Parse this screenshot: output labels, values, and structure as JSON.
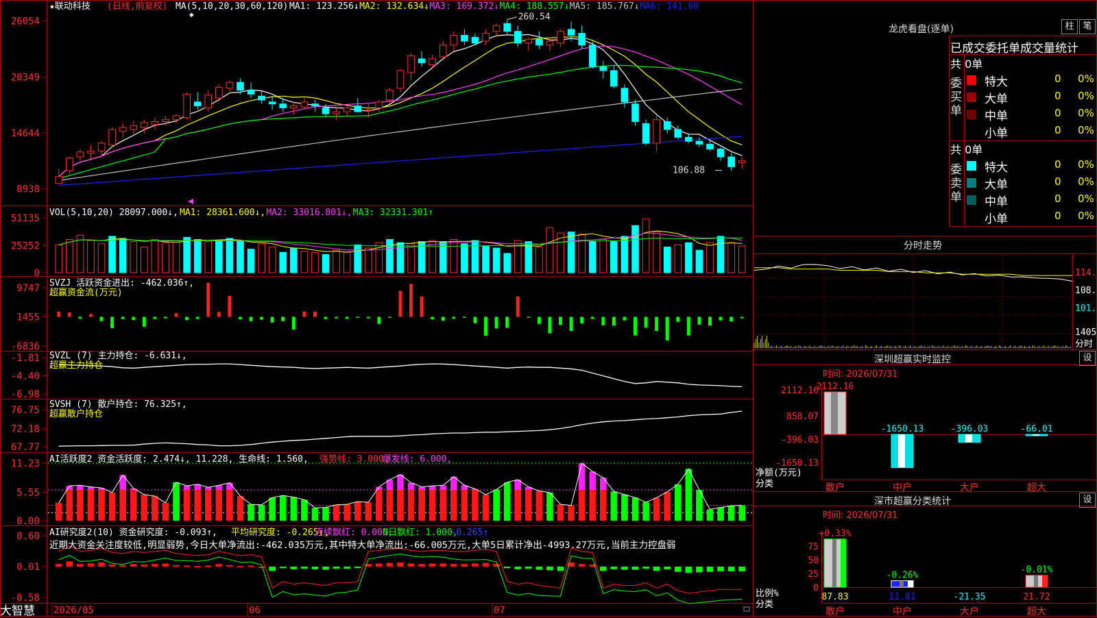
{
  "app": {
    "brand": "大智慧"
  },
  "main": {
    "stock_name": "联动科技",
    "period_label": "(日线,前复权)",
    "ma_label": "MA(5,10,20,30,60,120)",
    "ma_values": [
      {
        "label": "MA1: 123.256↓",
        "color": "#ffffff"
      },
      {
        "label": "MA2: 132.634↓",
        "color": "#ffff00"
      },
      {
        "label": "MA3: 169.372↓",
        "color": "#ff40ff"
      },
      {
        "label": "MA4: 188.557↓",
        "color": "#00ff00"
      },
      {
        "label": "MA5: 185.767↓",
        "color": "#c0c0c0"
      },
      {
        "label": "MA6: 141.60",
        "color": "#2020ff"
      }
    ],
    "y_ticks": [
      "26054",
      "20349",
      "14644",
      "8938"
    ],
    "high_label": "260.54",
    "low_label": "106.88",
    "x_ticks": [
      "2026/05",
      "06",
      "07"
    ]
  },
  "vol": {
    "label": "VOL(5,10,20) 28097.000↓,",
    "ma_labels": [
      {
        "label": "MA1: 28361.600↓,",
        "color": "#ffff00"
      },
      {
        "label": "MA2: 33016.801↓,",
        "color": "#ff40ff"
      },
      {
        "label": "MA3: 32331.301↑",
        "color": "#00ff00"
      }
    ],
    "y_ticks": [
      "51135",
      "25252",
      "0"
    ]
  },
  "svzj": {
    "label": "SVZJ  活跃资金进出: -462.036↑,",
    "sub_label": "超赢资金流(万元)",
    "y_ticks": [
      "9747",
      "1455",
      "-6836"
    ]
  },
  "svzl": {
    "label": "SVZL (7) 主力持仓: -6.631↓,",
    "sub_label": "超赢主力持仓",
    "y_ticks": [
      "-1.81",
      "-4.40",
      "-6.98"
    ]
  },
  "svsh": {
    "label": "SVSH (7) 散户持仓: 76.325↑,",
    "sub_label": "超赢散户持仓",
    "y_ticks": [
      "76.75",
      "72.18",
      "67.77"
    ]
  },
  "ai1": {
    "label": "AI活跃度2 资金活跃度: 2.474↓, 11.228, 生命线: 1.560,",
    "extra": [
      {
        "label": "强势线: 3.000,",
        "color": "#ff3030"
      },
      {
        "label": "爆发线: 6.000,",
        "color": "#ff40ff"
      }
    ],
    "y_ticks": [
      "11.23",
      "5.55",
      "0.00"
    ]
  },
  "ai2": {
    "label": "AI研究度2(10) 资金研究度: -0.093↑,",
    "extra": [
      {
        "label": "平均研究度: -0.265↑,",
        "color": "#ffff00"
      },
      {
        "label": "连续飘红: 0.000,",
        "color": "#ff40ff"
      },
      {
        "label": "N日飘红: 1.000,",
        "color": "#00ff00"
      },
      {
        "label": "-0.265↑",
        "color": "#4040ff"
      }
    ],
    "comment": "近期大资金关注度较低,明显弱势,今日大单净流出:-462.035万元,其中特大单净流出:-66.005万元,大单5日累计净出-4993.27万元,当前主力控盘弱",
    "y_ticks": [
      "0.60",
      "0.01",
      "-0.58"
    ]
  },
  "right": {
    "dragon": {
      "title": "龙虎看盘(逐单)",
      "btn1": "柱",
      "btn2": "笔",
      "header": "已成交委托单成交量统计",
      "buy_side": "委买单",
      "sell_side": "委卖单",
      "buy_total": "共 0单",
      "sell_total": "共 0单",
      "buy_rows": [
        {
          "name": "特大",
          "count": "0",
          "pct": "0%",
          "color": "#ff0000"
        },
        {
          "name": "大单",
          "count": "0",
          "pct": "0%",
          "color": "#a00000"
        },
        {
          "name": "中单",
          "count": "0",
          "pct": "0%",
          "color": "#700000"
        },
        {
          "name": "小单",
          "count": "0",
          "pct": "0%",
          "color": ""
        }
      ],
      "sell_rows": [
        {
          "name": "特大",
          "count": "0",
          "pct": "0%",
          "color": "#00ffff"
        },
        {
          "name": "大单",
          "count": "0",
          "pct": "0%",
          "color": "#008080"
        },
        {
          "name": "中单",
          "count": "0",
          "pct": "0%",
          "color": "#006060"
        },
        {
          "name": "小单",
          "count": "0",
          "pct": "0%",
          "color": ""
        }
      ]
    },
    "intraday": {
      "title": "分时走势",
      "price_ticks": [
        "114.8",
        "108.2",
        "101.5"
      ],
      "vol_tick": "1405",
      "vol_label": "分时"
    },
    "monitor": {
      "title": "深圳超赢实时监控",
      "settings": "设",
      "time": "时间: 2026/07/31",
      "y_ticks": [
        "2112.16",
        "858.07",
        "-396.03",
        "-1650.13"
      ],
      "unit_label": "净额(万元)",
      "cat_label": "分类",
      "categories": [
        "散户",
        "中户",
        "大户",
        "超大"
      ],
      "values": [
        2112.16,
        -1650.13,
        -396.03,
        -66.01
      ],
      "value_labels": [
        "2112.16",
        "-1650.13",
        "-396.03",
        "-66.01"
      ]
    },
    "classify": {
      "title": "深市超赢分类统计",
      "settings": "设",
      "time": "时间: 2026/07/31",
      "y_ticks": [
        "75",
        "50",
        "25",
        "0"
      ],
      "ratio_label": "比例%",
      "cat_label": "分类",
      "categories": [
        "散户",
        "中户",
        "大户",
        "超大"
      ],
      "bar_labels": [
        "+0.33%",
        "-0.26%",
        "",
        "-0.01%"
      ],
      "values": [
        87.83,
        11.81,
        -21.35,
        21.72
      ],
      "value_labels": [
        "87.83",
        "11.81",
        "-21.35",
        "21.72"
      ]
    }
  },
  "chart_data": {
    "type": "candlestick",
    "title": "联动科技",
    "x_axis_ticks": [
      "2026/05",
      "06",
      "07"
    ],
    "ylim": [
      8938,
      26054
    ],
    "high": 260.54,
    "low": 106.88,
    "candles": [
      [
        95,
        110,
        95,
        102
      ],
      [
        108,
        122,
        104,
        121
      ],
      [
        122,
        130,
        118,
        127
      ],
      [
        126,
        134,
        120,
        128
      ],
      [
        128,
        138,
        124,
        136
      ],
      [
        134,
        152,
        131,
        150
      ],
      [
        148,
        157,
        142,
        152
      ],
      [
        150,
        159,
        146,
        154
      ],
      [
        152,
        160,
        146,
        157
      ],
      [
        155,
        162,
        150,
        158
      ],
      [
        158,
        163,
        154,
        160
      ],
      [
        160,
        166,
        156,
        164
      ],
      [
        162,
        188,
        160,
        186
      ],
      [
        178,
        188,
        170,
        174
      ],
      [
        172,
        190,
        168,
        185
      ],
      [
        182,
        196,
        178,
        193
      ],
      [
        192,
        200,
        186,
        198
      ],
      [
        198,
        202,
        186,
        190
      ],
      [
        190,
        198,
        182,
        186
      ],
      [
        184,
        190,
        176,
        180
      ],
      [
        178,
        184,
        170,
        176
      ],
      [
        176,
        182,
        168,
        172
      ],
      [
        172,
        178,
        166,
        174
      ],
      [
        173,
        182,
        170,
        178
      ],
      [
        176,
        180,
        168,
        174
      ],
      [
        172,
        176,
        162,
        166
      ],
      [
        166,
        172,
        160,
        168
      ],
      [
        168,
        174,
        164,
        172
      ],
      [
        174,
        182,
        168,
        168
      ],
      [
        170,
        176,
        162,
        170
      ],
      [
        172,
        180,
        168,
        178
      ],
      [
        180,
        192,
        176,
        190
      ],
      [
        192,
        212,
        188,
        210
      ],
      [
        208,
        228,
        200,
        225
      ],
      [
        222,
        230,
        214,
        218
      ],
      [
        216,
        226,
        212,
        222
      ],
      [
        224,
        240,
        220,
        236
      ],
      [
        236,
        250,
        230,
        246
      ],
      [
        246,
        252,
        236,
        240
      ],
      [
        244,
        248,
        236,
        238
      ],
      [
        240,
        252,
        236,
        248
      ],
      [
        250,
        258,
        244,
        256
      ],
      [
        258,
        262,
        246,
        250
      ],
      [
        250,
        256,
        234,
        238
      ],
      [
        238,
        244,
        230,
        242
      ],
      [
        242,
        250,
        232,
        236
      ],
      [
        236,
        244,
        230,
        240
      ],
      [
        238,
        252,
        234,
        250
      ],
      [
        252,
        260,
        240,
        246
      ],
      [
        248,
        256,
        232,
        236
      ],
      [
        236,
        240,
        212,
        214
      ],
      [
        214,
        220,
        202,
        210
      ],
      [
        210,
        216,
        192,
        194
      ],
      [
        192,
        196,
        172,
        178
      ],
      [
        176,
        180,
        154,
        158
      ],
      [
        156,
        160,
        134,
        136
      ],
      [
        136,
        164,
        128,
        160
      ],
      [
        158,
        162,
        146,
        150
      ],
      [
        150,
        154,
        140,
        142
      ],
      [
        142,
        146,
        136,
        138
      ],
      [
        138,
        142,
        132,
        135
      ],
      [
        135,
        140,
        128,
        130
      ],
      [
        130,
        132,
        118,
        122
      ],
      [
        122,
        126,
        108,
        112
      ],
      [
        116,
        122,
        110,
        118
      ]
    ],
    "volume": [
      [
        26000,
        1
      ],
      [
        31000,
        1
      ],
      [
        35000,
        1
      ],
      [
        30000,
        1
      ],
      [
        27000,
        1
      ],
      [
        34000,
        0
      ],
      [
        32000,
        0
      ],
      [
        29000,
        1
      ],
      [
        24000,
        1
      ],
      [
        31000,
        1
      ],
      [
        28000,
        1
      ],
      [
        30000,
        1
      ],
      [
        33000,
        0
      ],
      [
        31000,
        0
      ],
      [
        29000,
        1
      ],
      [
        30000,
        0
      ],
      [
        32000,
        0
      ],
      [
        30000,
        0
      ],
      [
        22000,
        0
      ],
      [
        27000,
        1
      ],
      [
        24000,
        1
      ],
      [
        19000,
        0
      ],
      [
        23000,
        0
      ],
      [
        20000,
        1
      ],
      [
        19000,
        1
      ],
      [
        17000,
        0
      ],
      [
        21000,
        1
      ],
      [
        19000,
        1
      ],
      [
        26000,
        0
      ],
      [
        23000,
        1
      ],
      [
        28000,
        1
      ],
      [
        31000,
        0
      ],
      [
        28000,
        0
      ],
      [
        27000,
        1
      ],
      [
        29000,
        0
      ],
      [
        30000,
        1
      ],
      [
        29000,
        0
      ],
      [
        31000,
        1
      ],
      [
        27000,
        0
      ],
      [
        30000,
        0
      ],
      [
        25000,
        0
      ],
      [
        23000,
        0
      ],
      [
        18000,
        0
      ],
      [
        30000,
        1
      ],
      [
        29000,
        0
      ],
      [
        24000,
        1
      ],
      [
        42000,
        1
      ],
      [
        37000,
        1
      ],
      [
        38000,
        0
      ],
      [
        36000,
        1
      ],
      [
        29000,
        0
      ],
      [
        31000,
        1
      ],
      [
        29000,
        0
      ],
      [
        34000,
        0
      ],
      [
        44000,
        0
      ],
      [
        50000,
        1
      ],
      [
        38000,
        1
      ],
      [
        24000,
        0
      ],
      [
        26000,
        1
      ],
      [
        28000,
        0
      ],
      [
        21000,
        0
      ],
      [
        28000,
        1
      ],
      [
        34000,
        0
      ],
      [
        28000,
        1
      ],
      [
        25000,
        1
      ]
    ],
    "svzj": [
      1500,
      1300,
      -500,
      800,
      -1200,
      -3200,
      -600,
      -900,
      -2800,
      -600,
      -400,
      1100,
      -900,
      -600,
      9700,
      1400,
      6000,
      -700,
      -1200,
      -800,
      -1600,
      -1200,
      -3600,
      1500,
      1500,
      -600,
      -400,
      -500,
      -300,
      -400,
      -2000,
      -300,
      7400,
      9400,
      5800,
      -700,
      -1100,
      -500,
      -300,
      -1800,
      -5400,
      -3300,
      -3100,
      5800,
      -300,
      -2000,
      -4700,
      -2300,
      -4000,
      -1900,
      -600,
      -2400,
      -2500,
      -1000,
      -5300,
      -3100,
      -4000,
      -6700,
      -1400,
      -5300,
      -2200,
      -2500,
      -1000,
      -1300,
      -400
    ],
    "svzl": [
      -1.9,
      -1.95,
      -2.0,
      -2.05,
      -2.1,
      -2.2,
      -2.35,
      -2.4,
      -2.3,
      -2.2,
      -2.1,
      -2.0,
      -1.9,
      -1.85,
      -1.85,
      -1.8,
      -1.8,
      -1.9,
      -2.0,
      -2.1,
      -2.2,
      -2.25,
      -2.3,
      -2.4,
      -2.45,
      -2.4,
      -2.35,
      -2.3,
      -2.35,
      -2.4,
      -2.3,
      -2.2,
      -2.1,
      -1.95,
      -1.85,
      -1.8,
      -1.82,
      -1.9,
      -2.0,
      -2.1,
      -2.2,
      -2.3,
      -2.4,
      -2.3,
      -2.25,
      -2.3,
      -2.3,
      -2.4,
      -2.5,
      -2.7,
      -3.1,
      -3.5,
      -3.9,
      -4.3,
      -4.6,
      -4.5,
      -4.3,
      -4.4,
      -4.5,
      -4.7,
      -4.8,
      -4.85,
      -4.9,
      -5.0,
      -5.05
    ],
    "svsh": [
      67.9,
      67.95,
      68.0,
      68.0,
      68.05,
      68.1,
      68.1,
      68.15,
      68.4,
      68.6,
      68.7,
      68.6,
      68.5,
      68.3,
      68.2,
      68.0,
      68.0,
      68.1,
      68.3,
      68.6,
      68.9,
      69.1,
      69.3,
      69.4,
      69.6,
      69.8,
      70.0,
      70.2,
      70.3,
      70.3,
      70.3,
      70.3,
      70.4,
      70.6,
      70.7,
      70.9,
      71.0,
      71.1,
      71.1,
      71.2,
      71.3,
      71.3,
      71.4,
      71.5,
      71.6,
      71.7,
      71.9,
      72.2,
      72.6,
      73.1,
      73.5,
      73.8,
      74.0,
      74.1,
      74.3,
      74.5,
      74.6,
      74.8,
      75.0,
      75.3,
      75.5,
      75.6,
      75.7,
      76.1,
      76.4
    ],
    "ai1": [
      3.5,
      6.8,
      6.9,
      6.6,
      6.4,
      5.5,
      8.9,
      6.3,
      5.1,
      4.8,
      3.5,
      7.5,
      6.8,
      7.1,
      6.5,
      6.9,
      7.4,
      4.8,
      3.2,
      3.1,
      4.5,
      4.9,
      4.6,
      4.1,
      2.5,
      2.6,
      3.1,
      3.2,
      3.7,
      3.6,
      6.6,
      8.0,
      9.0,
      7.4,
      6.6,
      6.8,
      6.9,
      8.6,
      6.9,
      6.2,
      5.1,
      6.1,
      7.5,
      8.0,
      6.6,
      5.8,
      5.5,
      3.2,
      3.0,
      11.2,
      9.6,
      8.4,
      5.7,
      5.1,
      4.5,
      3.6,
      4.5,
      5.6,
      7.1,
      10.1,
      6.0,
      2.2,
      2.6,
      2.9,
      3.0,
      3.1,
      3.2,
      3.0,
      2.8
    ],
    "ai1_colors": "rrrrrrrrrrrgrrrrrrggggggggrrrrrrrrrrrrrrrggrrrgrrrrrggggrrggggggggg",
    "ai2": [
      0.05,
      0.1,
      0.05,
      0.06,
      0.08,
      0.04,
      0.03,
      0.05,
      0.04,
      0.05,
      0.06,
      0.03,
      0.02,
      0.01,
      0.02,
      0.05,
      0.03,
      0.01,
      0.02,
      0.0,
      -0.08,
      -0.03,
      -0.05,
      -0.04,
      -0.05,
      -0.06,
      -0.04,
      -0.04,
      -0.03,
      0.05,
      0.06,
      0.07,
      0.08,
      0.06,
      0.05,
      0.06,
      0.06,
      0.05,
      0.05,
      0.06,
      0.07,
      0.05,
      -0.03,
      -0.05,
      -0.04,
      -0.06,
      -0.07,
      -0.08,
      0.08,
      0.05,
      0.04,
      -0.08,
      -0.05,
      -0.06,
      -0.06,
      -0.04,
      -0.08,
      -0.05,
      -0.1,
      -0.12,
      -0.11,
      -0.1,
      -0.09,
      -0.09,
      -0.09
    ],
    "intraday_price": [
      113,
      114,
      116,
      115,
      117,
      118,
      116,
      115,
      115,
      114,
      114,
      113,
      113,
      112,
      112,
      111,
      111,
      110,
      110,
      109,
      109,
      108,
      108,
      107,
      107,
      106,
      105
    ],
    "intraday_avg": [
      115,
      115,
      115,
      114,
      114,
      114,
      114,
      113,
      113,
      113,
      113,
      112,
      112,
      112,
      111,
      111,
      111,
      110,
      110,
      110,
      110,
      110,
      109,
      109,
      109,
      109,
      109
    ]
  }
}
